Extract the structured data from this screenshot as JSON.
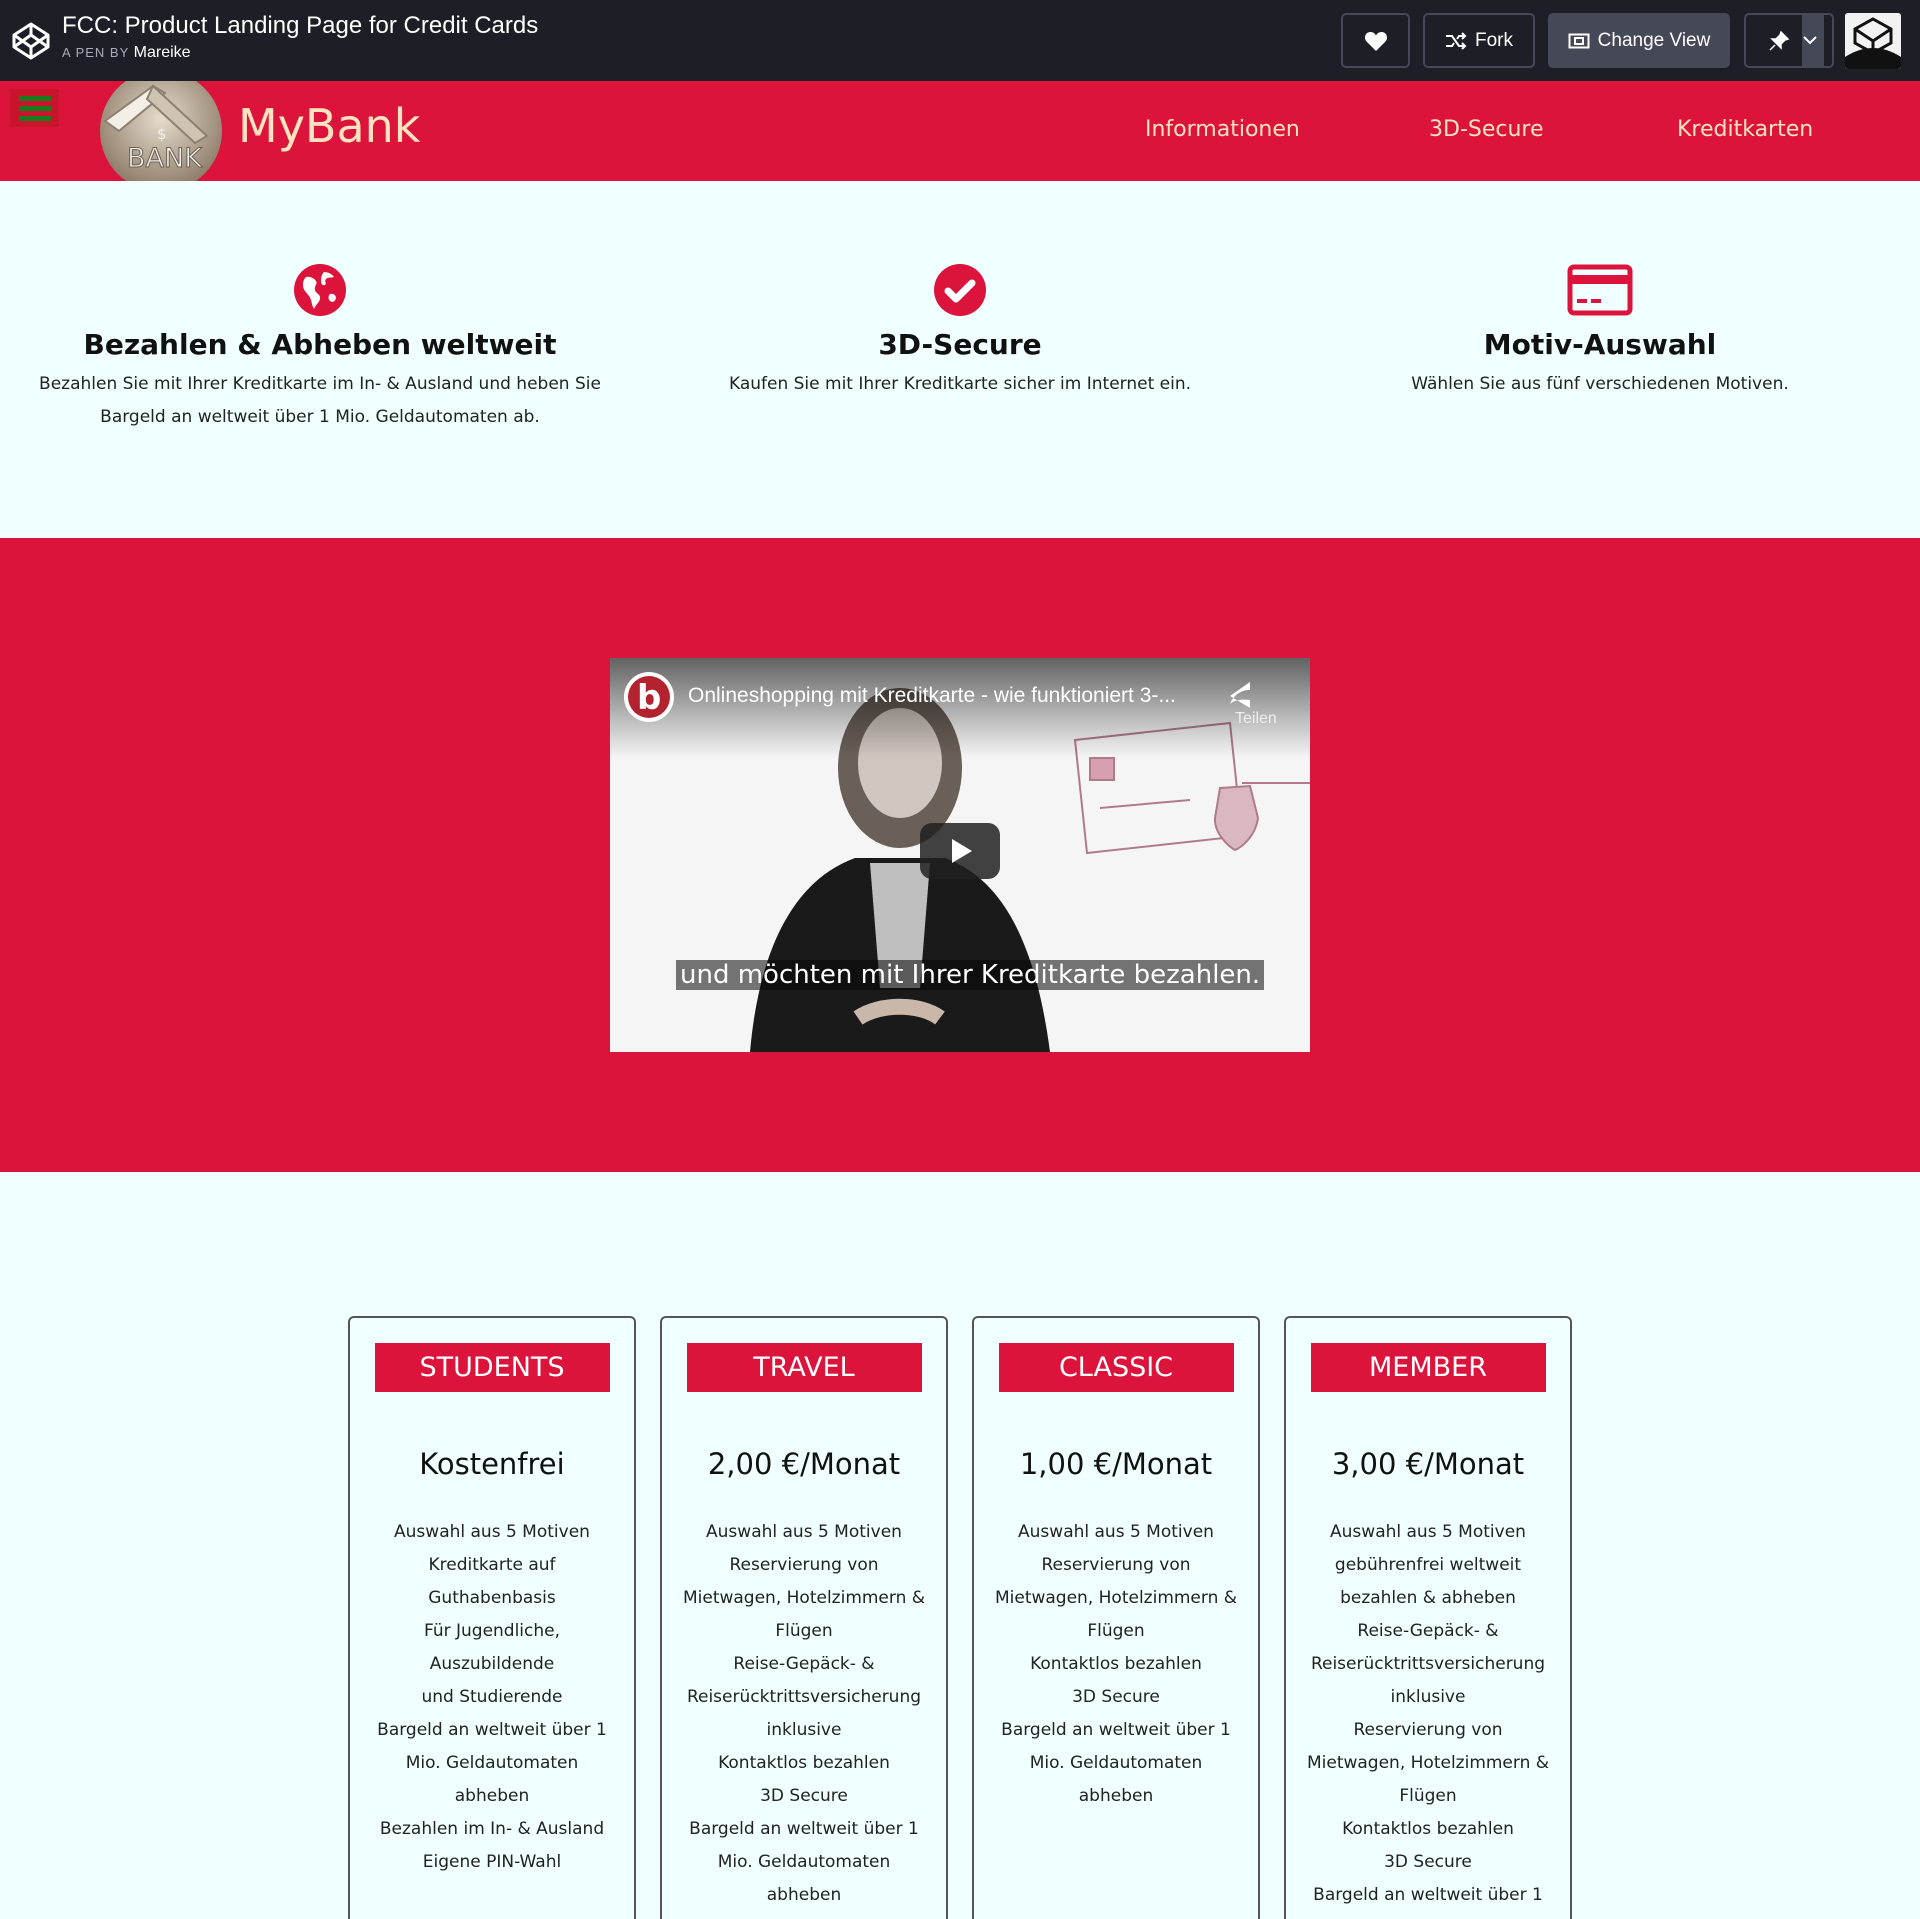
{
  "codepen": {
    "title": "FCC: Product Landing Page for Credit Cards",
    "by_prefix": "A PEN BY",
    "author": "Mareike",
    "fork_label": "Fork",
    "change_view_label": "Change View"
  },
  "site": {
    "brand": "MyBank",
    "logo_text": "BANK",
    "nav": [
      "Informationen",
      "3D-Secure",
      "Kreditkarten"
    ]
  },
  "features": [
    {
      "icon": "globe-icon",
      "title": "Bezahlen & Abheben weltweit",
      "text_line1": "Bezahlen Sie mit Ihrer Kreditkarte im In- & Ausland und heben Sie",
      "text_line2": "Bargeld an weltweit über 1 Mio. Geldautomaten ab."
    },
    {
      "icon": "check-circle-icon",
      "title": "3D-Secure",
      "text_line1": "Kaufen Sie mit Ihrer Kreditkarte sicher im Internet ein.",
      "text_line2": ""
    },
    {
      "icon": "credit-card-icon",
      "title": "Motiv-Auswahl",
      "text_line1": "Wählen Sie aus fünf verschiedenen Motiven.",
      "text_line2": ""
    }
  ],
  "video": {
    "channel_letter": "b",
    "title": "Onlineshopping mit Kreditkarte - wie funktioniert 3-...",
    "share_label": "Teilen",
    "caption": "und möchten mit Ihrer Kreditkarte bezahlen."
  },
  "plans": [
    {
      "name": "STUDENTS",
      "price": "Kostenfrei",
      "features": [
        "Auswahl aus 5 Motiven",
        "Kreditkarte auf",
        "Guthabenbasis",
        "Für Jugendliche,",
        "Auszubildende",
        "und Studierende",
        "Bargeld an weltweit über 1",
        "Mio. Geldautomaten",
        "abheben",
        "Bezahlen im In- & Ausland",
        "Eigene PIN-Wahl"
      ]
    },
    {
      "name": "TRAVEL",
      "price": "2,00 €/Monat",
      "features": [
        "Auswahl aus 5 Motiven",
        "Reservierung von",
        "Mietwagen, Hotelzimmern &",
        "Flügen",
        "Reise-Gepäck- &",
        "Reiserücktrittsversicherung",
        "inklusive",
        "Kontaktlos bezahlen",
        "3D Secure",
        "Bargeld an weltweit über 1",
        "Mio. Geldautomaten",
        "abheben"
      ]
    },
    {
      "name": "CLASSIC",
      "price": "1,00 €/Monat",
      "features": [
        "Auswahl aus 5 Motiven",
        "Reservierung von",
        "Mietwagen, Hotelzimmern &",
        "Flügen",
        "Kontaktlos bezahlen",
        "3D Secure",
        "Bargeld an weltweit über 1",
        "Mio. Geldautomaten",
        "abheben"
      ]
    },
    {
      "name": "MEMBER",
      "price": "3,00 €/Monat",
      "features": [
        "Auswahl aus 5 Motiven",
        "gebührenfrei weltweit",
        "bezahlen & abheben",
        "Reise-Gepäck- &",
        "Reiserücktrittsversicherung",
        "inklusive",
        "Reservierung von",
        "Mietwagen, Hotelzimmern &",
        "Flügen",
        "Kontaktlos bezahlen",
        "3D Secure",
        "Bargeld an weltweit über 1"
      ]
    }
  ],
  "colors": {
    "accent": "#dc143c",
    "nav_text": "#fde3c0",
    "page_bg": "#f0ffff",
    "codepen_bar": "#1e1f26"
  }
}
